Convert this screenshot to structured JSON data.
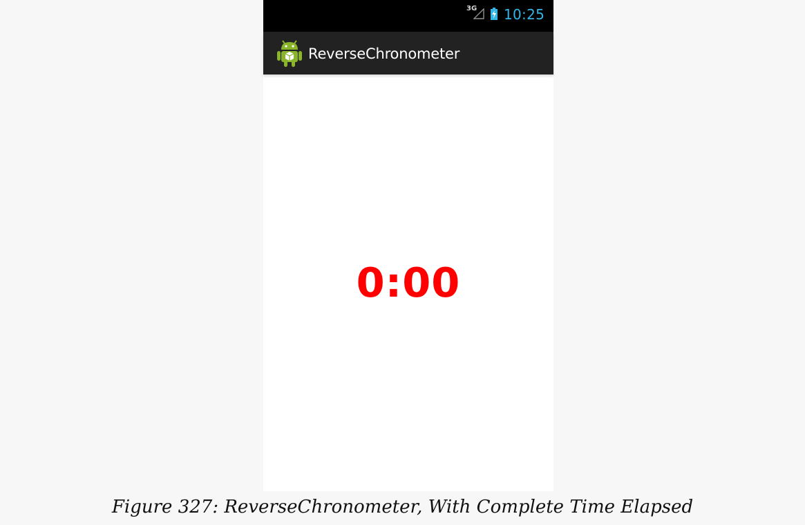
{
  "status_bar": {
    "network_type": "3G",
    "time": "10:25",
    "icons": [
      "signal-icon",
      "battery-charging-icon"
    ],
    "time_color": "#33b5e5"
  },
  "action_bar": {
    "app_icon": "android-app-icon",
    "title": "ReverseChronometer"
  },
  "main": {
    "timer_value": "0:00",
    "timer_color": "#ff0000"
  },
  "caption": {
    "text": "Figure 327: ReverseChronometer, With Complete Time Elapsed"
  }
}
